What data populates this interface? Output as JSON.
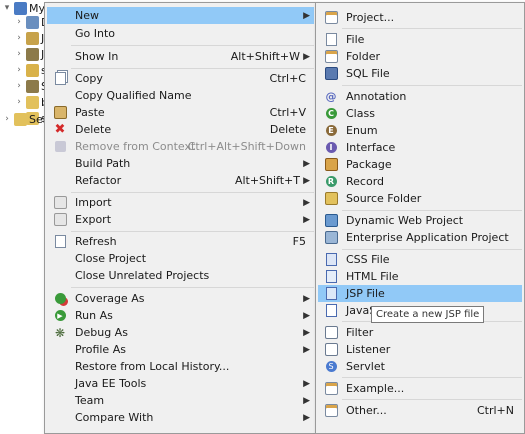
{
  "tree": {
    "items": [
      {
        "label": "MynewPJ",
        "twisty": "▾"
      },
      {
        "label": "D",
        "twisty": "›"
      },
      {
        "label": "JA",
        "twisty": "›"
      },
      {
        "label": "JR",
        "twisty": "›"
      },
      {
        "label": "sr",
        "twisty": "›"
      },
      {
        "label": "Se",
        "twisty": "›"
      },
      {
        "label": "bu",
        "twisty": "›"
      },
      {
        "label": "sr",
        "twisty": "›"
      },
      {
        "label": "Serve",
        "twisty": "›"
      }
    ]
  },
  "context_menu": {
    "items": [
      {
        "label": "New",
        "accel": "",
        "submenu": true,
        "highlighted": true,
        "icon": "",
        "disabled": false
      },
      {
        "label": "Go Into",
        "accel": "",
        "submenu": false,
        "icon": "",
        "disabled": false
      },
      {
        "label": "Show In",
        "accel": "Alt+Shift+W",
        "submenu": true,
        "icon": "",
        "disabled": false
      },
      {
        "label": "Copy",
        "accel": "Ctrl+C",
        "submenu": false,
        "icon": "copy-icon",
        "disabled": false
      },
      {
        "label": "Copy Qualified Name",
        "accel": "",
        "submenu": false,
        "icon": "",
        "disabled": false
      },
      {
        "label": "Paste",
        "accel": "Ctrl+V",
        "submenu": false,
        "icon": "paste-icon",
        "disabled": false
      },
      {
        "label": "Delete",
        "accel": "Delete",
        "submenu": false,
        "icon": "delete-icon",
        "disabled": false
      },
      {
        "label": "Remove from Context",
        "accel": "Ctrl+Alt+Shift+Down",
        "submenu": false,
        "icon": "remove-context-icon",
        "disabled": true
      },
      {
        "label": "Build Path",
        "accel": "",
        "submenu": true,
        "icon": "",
        "disabled": false
      },
      {
        "label": "Refactor",
        "accel": "Alt+Shift+T",
        "submenu": true,
        "icon": "",
        "disabled": false
      },
      {
        "label": "Import",
        "accel": "",
        "submenu": true,
        "icon": "import-icon",
        "disabled": false
      },
      {
        "label": "Export",
        "accel": "",
        "submenu": true,
        "icon": "export-icon",
        "disabled": false
      },
      {
        "label": "Refresh",
        "accel": "F5",
        "submenu": false,
        "icon": "refresh-icon",
        "disabled": false
      },
      {
        "label": "Close Project",
        "accel": "",
        "submenu": false,
        "icon": "",
        "disabled": false
      },
      {
        "label": "Close Unrelated Projects",
        "accel": "",
        "submenu": false,
        "icon": "",
        "disabled": false
      },
      {
        "label": "Coverage As",
        "accel": "",
        "submenu": true,
        "icon": "coverage-icon",
        "disabled": false
      },
      {
        "label": "Run As",
        "accel": "",
        "submenu": true,
        "icon": "run-icon",
        "disabled": false
      },
      {
        "label": "Debug As",
        "accel": "",
        "submenu": true,
        "icon": "debug-icon",
        "disabled": false
      },
      {
        "label": "Profile As",
        "accel": "",
        "submenu": true,
        "icon": "",
        "disabled": false
      },
      {
        "label": "Restore from Local History...",
        "accel": "",
        "submenu": false,
        "icon": "",
        "disabled": false
      },
      {
        "label": "Java EE Tools",
        "accel": "",
        "submenu": true,
        "icon": "",
        "disabled": false
      },
      {
        "label": "Team",
        "accel": "",
        "submenu": true,
        "icon": "",
        "disabled": false
      },
      {
        "label": "Compare With",
        "accel": "",
        "submenu": true,
        "icon": "",
        "disabled": false
      }
    ]
  },
  "new_submenu": {
    "items": [
      {
        "label": "Project...",
        "accel": "",
        "icon": "project-icon"
      },
      {
        "label": "File",
        "accel": "",
        "icon": "file-icon"
      },
      {
        "label": "Folder",
        "accel": "",
        "icon": "folder-icon"
      },
      {
        "label": "SQL File",
        "accel": "",
        "icon": "sql-file-icon"
      },
      {
        "label": "Annotation",
        "accel": "",
        "icon": "annotation-icon"
      },
      {
        "label": "Class",
        "accel": "",
        "icon": "class-icon"
      },
      {
        "label": "Enum",
        "accel": "",
        "icon": "enum-icon"
      },
      {
        "label": "Interface",
        "accel": "",
        "icon": "interface-icon"
      },
      {
        "label": "Package",
        "accel": "",
        "icon": "package-icon"
      },
      {
        "label": "Record",
        "accel": "",
        "icon": "record-icon"
      },
      {
        "label": "Source Folder",
        "accel": "",
        "icon": "source-folder-icon"
      },
      {
        "label": "Dynamic Web Project",
        "accel": "",
        "icon": "dynamic-web-project-icon"
      },
      {
        "label": "Enterprise Application Project",
        "accel": "",
        "icon": "enterprise-project-icon"
      },
      {
        "label": "CSS File",
        "accel": "",
        "icon": "css-file-icon"
      },
      {
        "label": "HTML File",
        "accel": "",
        "icon": "html-file-icon"
      },
      {
        "label": "JSP File",
        "accel": "",
        "icon": "jsp-file-icon",
        "highlighted": true
      },
      {
        "label": "JavaScript File",
        "accel": "",
        "icon": "javascript-file-icon"
      },
      {
        "label": "Filter",
        "accel": "",
        "icon": "filter-icon"
      },
      {
        "label": "Listener",
        "accel": "",
        "icon": "listener-icon"
      },
      {
        "label": "Servlet",
        "accel": "",
        "icon": "servlet-icon"
      },
      {
        "label": "Example...",
        "accel": "",
        "icon": "example-icon"
      },
      {
        "label": "Other...",
        "accel": "Ctrl+N",
        "icon": "other-icon"
      }
    ]
  },
  "tooltip": {
    "text": "Create a new JSP file"
  },
  "colors": {
    "highlight": "#91c9f7",
    "menu_bg": "#f0f0f0"
  }
}
